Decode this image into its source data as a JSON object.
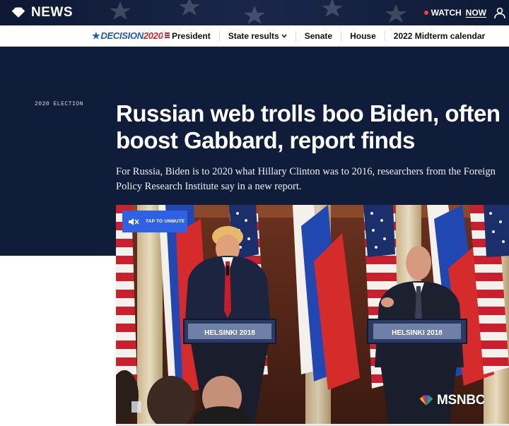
{
  "header": {
    "logo_text": "NEWS",
    "watch_label": "WATCH",
    "watch_now": "NOW"
  },
  "nav": {
    "brand_prefix": "DECISION",
    "brand_year": "2020",
    "items": [
      "President",
      "State results",
      "Senate",
      "House",
      "2022 Midterm calendar"
    ]
  },
  "article": {
    "kicker": "2020 ELECTION",
    "headline_line1": "Russian web trolls boo Biden, often",
    "headline_line2": "boost Gabbard, report finds",
    "dek": "For Russia, Biden is to 2020 what Hillary Clinton was to 2016, researchers from the Foreign Policy Research Institute say in a new report."
  },
  "video": {
    "unmute_label": "TAP TO UNMUTE",
    "podium_left": "HELSINKI 2018",
    "podium_right": "HELSINKI 2018",
    "network": "MSNBC"
  },
  "colors": {
    "topbar": "#0d1833",
    "hero_bg": "#0f1c3a",
    "accent_blue": "#2f62e3",
    "brand_blue": "#1f58c4",
    "brand_red": "#d8232a"
  },
  "icons": {
    "logo": "peacock-icon",
    "live": "live-dot-icon",
    "account": "user-icon",
    "nav_caret": "chevron-down-icon",
    "unmute": "speaker-muted-icon",
    "network_logo": "msnbc-peacock-icon"
  }
}
